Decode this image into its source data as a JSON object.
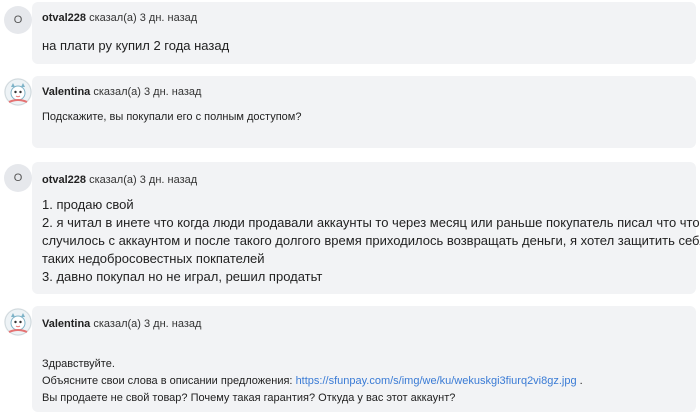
{
  "messages": [
    {
      "author": "otval228",
      "action": "сказал(а)",
      "time": "3 дн. назад",
      "avatar_letter": "O",
      "lines": [
        "на плати ру купил 2 года назад"
      ]
    },
    {
      "author": "Valentina",
      "action": "сказал(а)",
      "time": "3 дн. назад",
      "lines": [
        "Подскажите, вы покупали его с полным доступом?"
      ]
    },
    {
      "author": "otval228",
      "action": "сказал(а)",
      "time": "3 дн. назад",
      "avatar_letter": "O",
      "lines": [
        "1. продаю свой",
        "2. я читал в инете что когда люди продавали аккаунты то через месяц или раньше покупатель писал что что-то",
        "случилось с аккаунтом и после такого долгого время приходилось возвращать деньги, я хотел защитить себя от",
        "таких недобросовестных покпателей",
        "3. давно покупал но не играл, решил продатьт"
      ]
    },
    {
      "author": "Valentina",
      "action": "сказал(а)",
      "time": "3 дн. назад",
      "greeting": "Здравствуйте.",
      "explain_prefix": "Объясните свои слова в описании предложения: ",
      "link": "https://sfunpay.com/s/img/we/ku/wekuskgi3fiurq2vi8gz.jpg",
      "explain_suffix": " .",
      "question": "Вы продаете не свой товар? Почему такая гарантия? Откуда у вас этот аккаунт?"
    }
  ],
  "colors": {
    "bubble": "#f2f3f5",
    "link": "#3a7bd5",
    "avatar_bg": "#e6e8ec"
  }
}
